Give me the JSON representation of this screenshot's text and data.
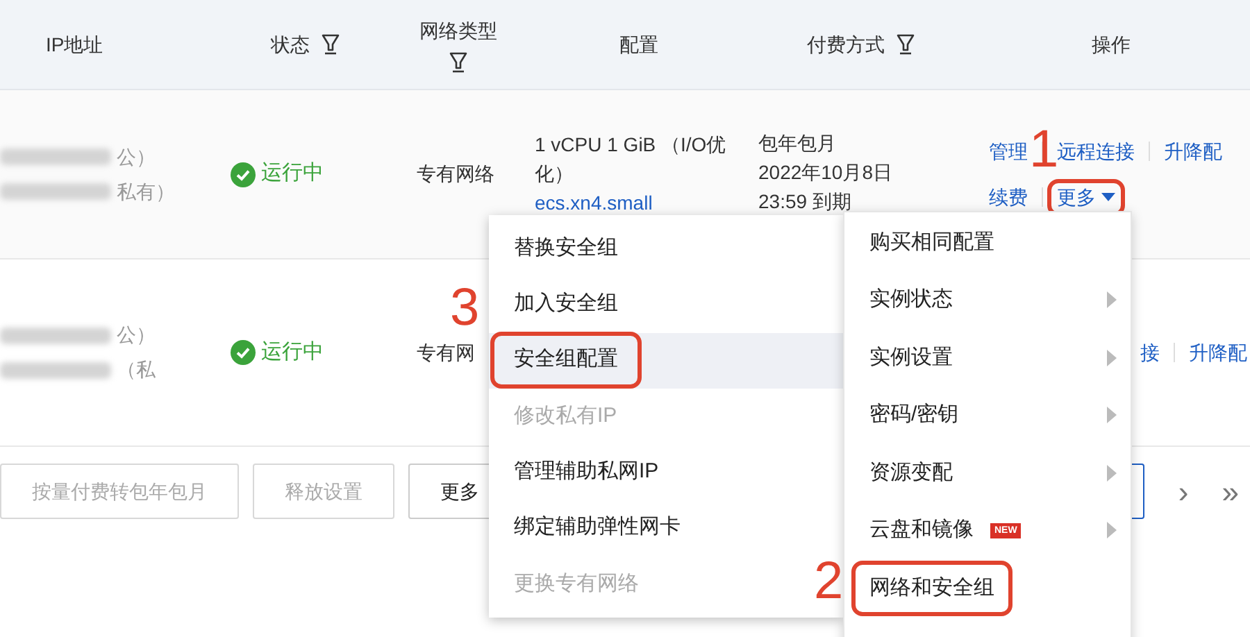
{
  "table": {
    "columns": [
      {
        "label": "IP地址",
        "filter": false
      },
      {
        "label": "状态",
        "filter": true
      },
      {
        "label": "网络类型",
        "filter": true
      },
      {
        "label": "配置",
        "filter": false
      },
      {
        "label": "付费方式",
        "filter": true
      },
      {
        "label": "操作",
        "filter": false
      }
    ],
    "rows": [
      {
        "ip_notes": [
          "公）",
          "私有）"
        ],
        "status": "运行中",
        "network": "专有网络",
        "config": [
          "1 vCPU 1 GiB （I/O优化）"
        ],
        "instance_type": "ecs.xn4.small",
        "billing": [
          "包年包月",
          "2022年10月8日",
          "23:59 到期"
        ],
        "actions": [
          {
            "label": "管理",
            "kind": "link",
            "highlighted": false
          },
          {
            "label": "远程连接",
            "kind": "link",
            "highlighted": false
          },
          {
            "label": "升降配",
            "kind": "link",
            "highlighted": false
          },
          {
            "label": "续费",
            "kind": "link",
            "highlighted": false
          },
          {
            "label": "更多",
            "kind": "dropdown",
            "highlighted": true
          }
        ]
      },
      {
        "ip_notes": [
          "公）",
          "（私"
        ],
        "status": "运行中",
        "network": "专有网",
        "config": [],
        "billing": [],
        "actions": [
          {
            "label": "接",
            "kind": "link",
            "highlighted": false
          },
          {
            "label": "升降配",
            "kind": "link",
            "highlighted": false
          }
        ]
      }
    ]
  },
  "toolbar": [
    {
      "label": "按量付费转包年包月",
      "disabled": true
    },
    {
      "label": "释放设置",
      "disabled": true
    },
    {
      "label": "更多",
      "disabled": false
    }
  ],
  "pagination": {
    "next": "›",
    "last": "»"
  },
  "submenu": [
    {
      "label": "替换安全组",
      "disabled": false,
      "hovered": false,
      "highlighted": false
    },
    {
      "label": "加入安全组",
      "disabled": false,
      "hovered": false,
      "highlighted": false
    },
    {
      "label": "安全组配置",
      "disabled": false,
      "hovered": true,
      "highlighted": true
    },
    {
      "label": "修改私有IP",
      "disabled": true,
      "hovered": false,
      "highlighted": false
    },
    {
      "label": "管理辅助私网IP",
      "disabled": false,
      "hovered": false,
      "highlighted": false
    },
    {
      "label": "绑定辅助弹性网卡",
      "disabled": false,
      "hovered": false,
      "highlighted": false
    },
    {
      "label": "更换专有网络",
      "disabled": true,
      "hovered": false,
      "highlighted": false
    }
  ],
  "menu": [
    {
      "label": "购买相同配置",
      "has_submenu": false,
      "highlighted": false
    },
    {
      "label": "实例状态",
      "has_submenu": true,
      "highlighted": false
    },
    {
      "label": "实例设置",
      "has_submenu": true,
      "highlighted": false
    },
    {
      "label": "密码/密钥",
      "has_submenu": true,
      "highlighted": false
    },
    {
      "label": "资源变配",
      "has_submenu": true,
      "highlighted": false
    },
    {
      "label": "云盘和镜像",
      "has_submenu": true,
      "highlighted": false,
      "badge": "NEW"
    },
    {
      "label": "网络和安全组",
      "has_submenu": false,
      "highlighted": true
    }
  ],
  "annotations": [
    {
      "label": "1",
      "kind": "step"
    },
    {
      "label": "2",
      "kind": "step"
    },
    {
      "label": "3",
      "kind": "step"
    }
  ]
}
